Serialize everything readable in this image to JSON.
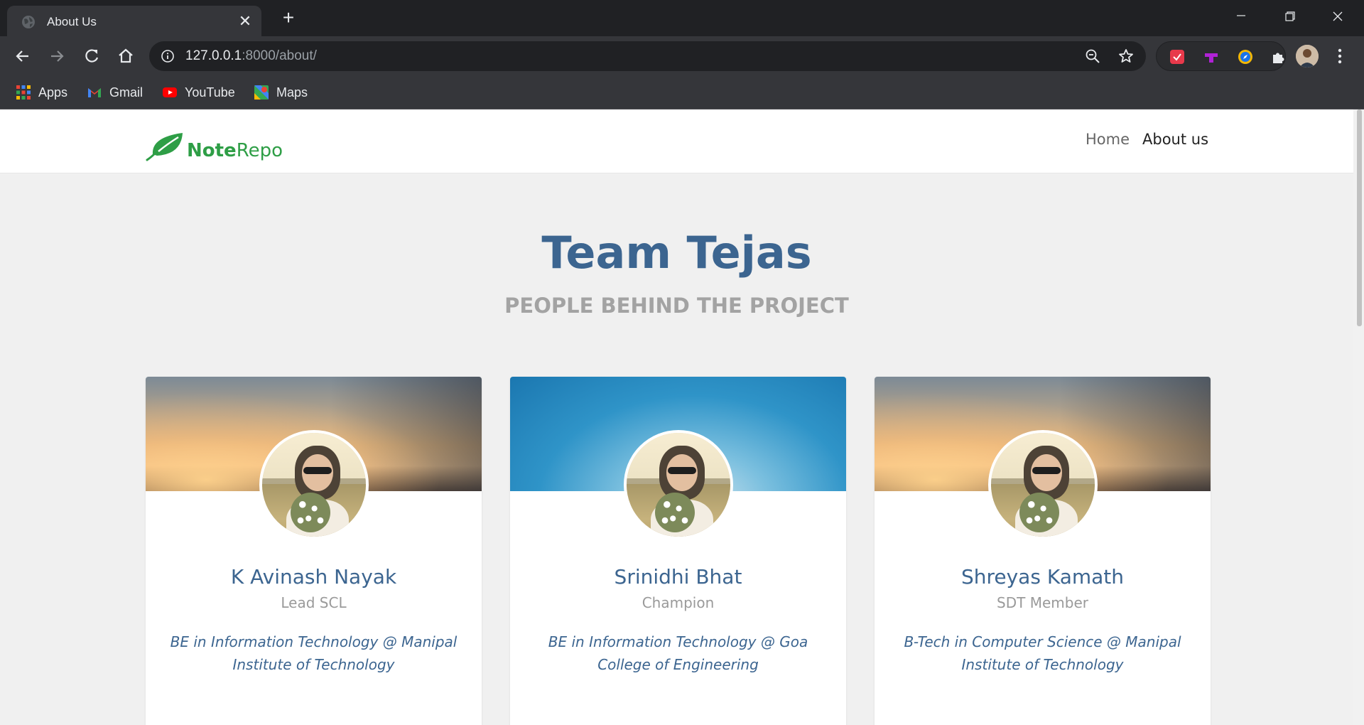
{
  "browser": {
    "tab_title": "About Us",
    "url_host": "127.0.0.1",
    "url_rest": ":8000/about/",
    "bookmarks": [
      {
        "label": "Apps",
        "icon": "apps-grid-icon"
      },
      {
        "label": "Gmail",
        "icon": "gmail-icon"
      },
      {
        "label": "YouTube",
        "icon": "youtube-icon"
      },
      {
        "label": "Maps",
        "icon": "maps-icon"
      }
    ]
  },
  "navbar": {
    "brand_bold": "Note",
    "brand_light": "Repo",
    "links": [
      {
        "label": "Home"
      },
      {
        "label": "About us"
      }
    ]
  },
  "hero": {
    "title": "Team Tejas",
    "subtitle": "PEOPLE BEHIND THE PROJECT"
  },
  "members": [
    {
      "name": "K Avinash Nayak",
      "role": "Lead SCL",
      "bio": "BE in Information Technology @ Manipal Institute of Technology",
      "cover": "sunset"
    },
    {
      "name": "Srinidhi Bhat",
      "role": "Champion",
      "bio": "BE in Information Technology @ Goa College of Engineering",
      "cover": "blue"
    },
    {
      "name": "Shreyas Kamath",
      "role": "SDT Member",
      "bio": "B-Tech in Computer Science @ Manipal Institute of Technology",
      "cover": "sunset"
    }
  ],
  "colors": {
    "brand_green": "#2e9e46",
    "heading_blue": "#3c6590",
    "muted_gray": "#9a9a9a",
    "page_bg": "#f0f0f0"
  }
}
